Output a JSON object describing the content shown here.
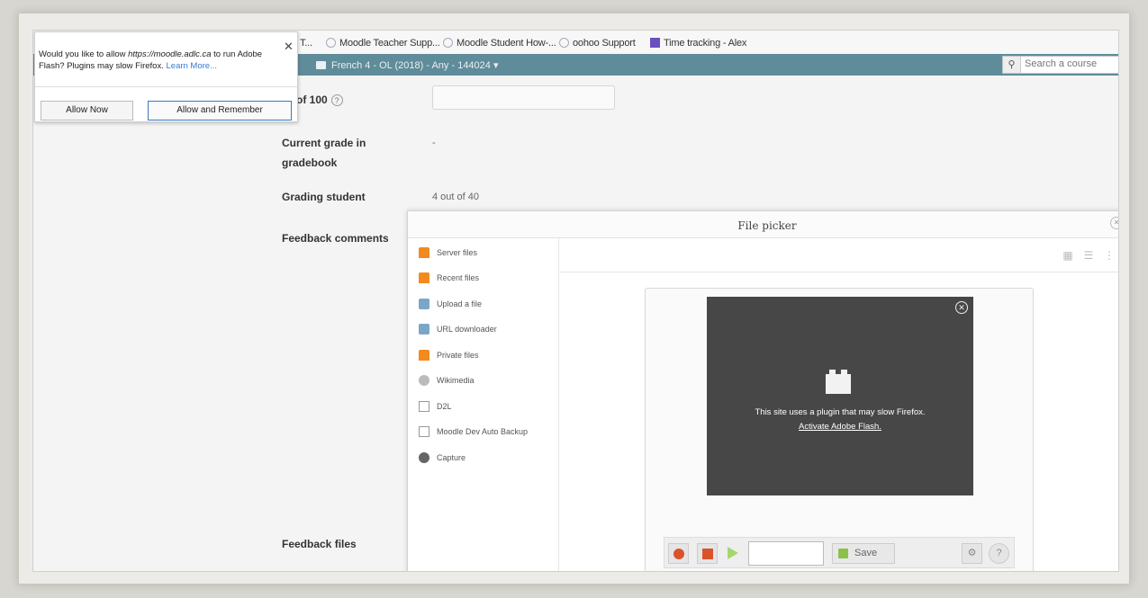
{
  "bookmarks": [
    {
      "label": "Moodle Teacher Supp...",
      "icon": "globe-icon"
    },
    {
      "label": "Moodle Student How-...",
      "icon": "globe-icon"
    },
    {
      "label": "oohoo Support",
      "icon": "globe-icon"
    },
    {
      "label": "Time tracking - Alex",
      "icon": "tracker-icon"
    }
  ],
  "bookmarks_lead": "T...",
  "nav": {
    "course": "French 4 - OL (2018) - Any - 144024",
    "course_caret": "▾",
    "search_placeholder": "Search a course"
  },
  "form": {
    "grade_label": "e out of 100",
    "current_grade_label_1": "Current grade in",
    "current_grade_label_2": "gradebook",
    "current_grade_value": "-",
    "grading_student_label": "Grading student",
    "grading_student_value": "4 out of 40",
    "feedback_comments_label": "Feedback comments",
    "feedback_files_label": "Feedback files"
  },
  "popup": {
    "text_1": "Would you like to allow ",
    "url": "https://moodle.adlc.ca",
    "text_2": " to run Adobe Flash? Plugins may slow Firefox. ",
    "learn_more": "Learn More...",
    "allow_now": "Allow Now",
    "allow_remember": "Allow and Remember"
  },
  "file_picker": {
    "title": "File picker",
    "repositories": [
      {
        "label": "Server files",
        "icon": "moodle-icon"
      },
      {
        "label": "Recent files",
        "icon": "moodle-icon"
      },
      {
        "label": "Upload a file",
        "icon": "upload-icon"
      },
      {
        "label": "URL downloader",
        "icon": "upload-icon"
      },
      {
        "label": "Private files",
        "icon": "moodle-icon"
      },
      {
        "label": "Wikimedia",
        "icon": "wikimedia-icon"
      },
      {
        "label": "D2L",
        "icon": "box-icon"
      },
      {
        "label": "Moodle Dev Auto Backup",
        "icon": "box-icon"
      },
      {
        "label": "Capture",
        "icon": "camera-icon"
      }
    ],
    "flash_message": "This site uses a plugin that may slow Firefox.",
    "flash_link": "Activate Adobe Flash.",
    "save_label": "Save"
  }
}
